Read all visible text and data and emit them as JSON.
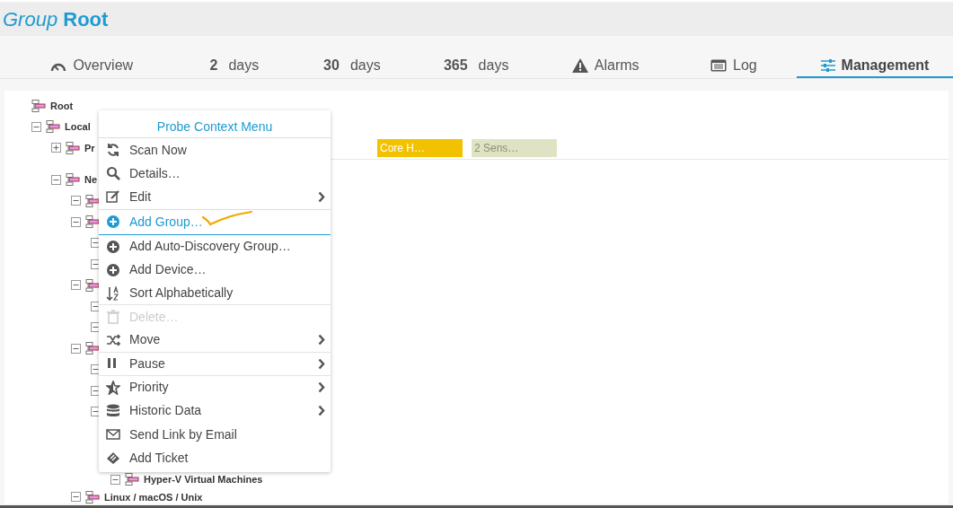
{
  "header": {
    "title_prefix": "Group",
    "title": "Root"
  },
  "tabs": [
    {
      "kind": "icon",
      "label": "Overview",
      "selected": false
    },
    {
      "kind": "days",
      "number": "2",
      "label": "days",
      "selected": false
    },
    {
      "kind": "days",
      "number": "30",
      "label": "days",
      "selected": false
    },
    {
      "kind": "days",
      "number": "365",
      "label": "days",
      "selected": false
    },
    {
      "kind": "icon",
      "label": "Alarms",
      "selected": false
    },
    {
      "kind": "icon",
      "label": "Log",
      "selected": false
    },
    {
      "kind": "icon",
      "label": "Management",
      "selected": true
    }
  ],
  "tree": {
    "label": "Root",
    "children": [
      {
        "label": "Local",
        "expanded": true,
        "children": [
          {
            "label": "Pr",
            "expanded": false,
            "tags": [
              {
                "label": "Core H…",
                "color": "#f2c200"
              },
              {
                "label": "2 Sens…",
                "color": "#dfe3c4"
              }
            ]
          },
          {
            "label": "Ne",
            "expanded": true,
            "children": [
              {
                "expanded": true
              },
              {
                "expanded": true,
                "children": [
                  {
                    "expanded": true
                  },
                  {
                    "expanded": true
                  }
                ]
              },
              {
                "expanded": true,
                "children": [
                  {
                    "expanded": true
                  },
                  {
                    "expanded": true
                  }
                ]
              },
              {
                "expanded": true,
                "children": [
                  {
                    "expanded": true
                  },
                  {
                    "expanded": true
                  },
                  {
                    "expanded": true,
                    "children": [
                      {
                        "label": "Hyper-V Virtual Machines",
                        "expanded": true
                      }
                    ]
                  }
                ]
              },
              {
                "label": "Linux / macOS / Unix",
                "expanded": true
              }
            ]
          }
        ]
      }
    ]
  },
  "context_menu": {
    "title": "Probe Context Menu",
    "items": [
      {
        "label": "Scan Now",
        "selected": false,
        "disabled": false,
        "submenu": false,
        "separator": false
      },
      {
        "label": "Details…",
        "selected": false,
        "disabled": false,
        "submenu": false,
        "separator": false
      },
      {
        "label": "Edit",
        "selected": false,
        "disabled": false,
        "submenu": true,
        "separator": false
      },
      {
        "label": "Add Group…",
        "selected": true,
        "disabled": false,
        "submenu": false,
        "separator": false
      },
      {
        "label": "Add Auto-Discovery Group…",
        "selected": false,
        "disabled": false,
        "submenu": false,
        "separator": false
      },
      {
        "label": "Add Device…",
        "selected": false,
        "disabled": false,
        "submenu": false,
        "separator": false
      },
      {
        "label": "Sort Alphabetically",
        "selected": false,
        "disabled": false,
        "submenu": false,
        "separator": true
      },
      {
        "label": "Delete…",
        "selected": false,
        "disabled": true,
        "submenu": false,
        "separator": false
      },
      {
        "label": "Move",
        "selected": false,
        "disabled": false,
        "submenu": true,
        "separator": true
      },
      {
        "label": "Pause",
        "selected": false,
        "disabled": false,
        "submenu": true,
        "separator": true
      },
      {
        "label": "Priority",
        "selected": false,
        "disabled": false,
        "submenu": true,
        "separator": false
      },
      {
        "label": "Historic Data",
        "selected": false,
        "disabled": false,
        "submenu": true,
        "separator": false
      },
      {
        "label": "Send Link by Email",
        "selected": false,
        "disabled": false,
        "submenu": false,
        "separator": false
      },
      {
        "label": "Add Ticket",
        "selected": false,
        "disabled": false,
        "submenu": false,
        "separator": false
      }
    ]
  }
}
